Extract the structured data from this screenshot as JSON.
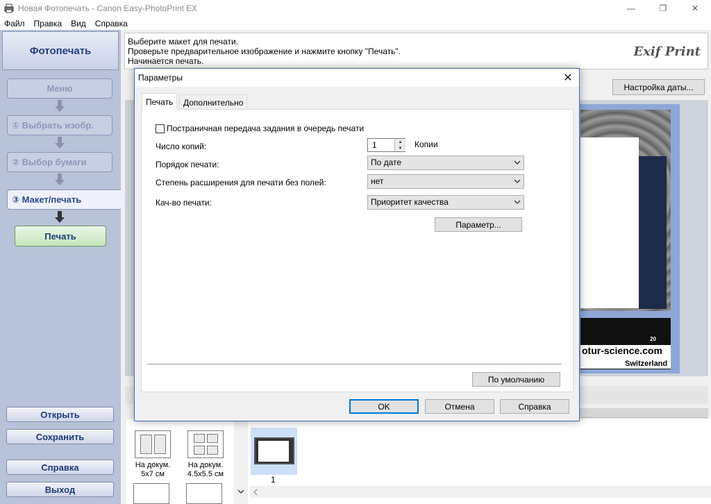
{
  "window": {
    "title": "Новая Фотопечать - Canon Easy-PhotoPrint EX",
    "minimize": "—",
    "maximize": "❐",
    "close": "✕"
  },
  "menu": [
    "Файл",
    "Правка",
    "Вид",
    "Справка"
  ],
  "left_panel": {
    "header": "Фотопечать",
    "steps": {
      "menu": "Меню",
      "select_images": "① Выбрать изобр.",
      "paper": "② Выбор бумаги",
      "layout": "③ Макет/печать"
    },
    "print_button": "Печать",
    "open_button": "Открыть",
    "save_button": "Сохранить",
    "help_button": "Справка",
    "exit_button": "Выход"
  },
  "instructions": {
    "line1": "Выберите макет для печати.",
    "line2": "Проверьте предварительное изображение и нажмите кнопку \"Печать\".",
    "line3": "Начинается печать.",
    "logo": "Exif Print"
  },
  "date_settings_button": "Настройка даты...",
  "preview": {
    "site_text": "otur-science.com",
    "site_sub": "Switzerland",
    "number": "20"
  },
  "layouts": [
    {
      "label1": "На докум.",
      "label2": "5x7 см"
    },
    {
      "label1": "На докум.",
      "label2": "4.5x5.5 см"
    }
  ],
  "thumbnail_number": "1",
  "dialog": {
    "title": "Параметры",
    "close": "✕",
    "tabs": [
      "Печать",
      "Дополнительно"
    ],
    "page_spool_checkbox": "Постраничная передача задания в очередь печати",
    "copies_label": "Число копий:",
    "copies_value": "1",
    "copies_unit": "Копии",
    "order_label": "Порядок печати:",
    "order_value": "По дате",
    "extension_label": "Степень расширения для печати без полей:",
    "extension_value": "нет",
    "quality_label": "Кач-во печати:",
    "quality_value": "Приоритет качества",
    "param_button": "Параметр...",
    "defaults_button": "По умолчанию",
    "ok_button": "OK",
    "cancel_button": "Отмена",
    "help_button": "Справка"
  },
  "colors": {
    "accent": "#0078d7",
    "left_panel_bg": "#b8c2d8",
    "header_text": "#223f86",
    "print_button_bg": "#c5e5bc"
  },
  "icons": {
    "app": "printer-icon",
    "step_arrow": "arrow-down-icon",
    "select": "chevron-down-icon",
    "spin": "spin-arrows-icon"
  }
}
